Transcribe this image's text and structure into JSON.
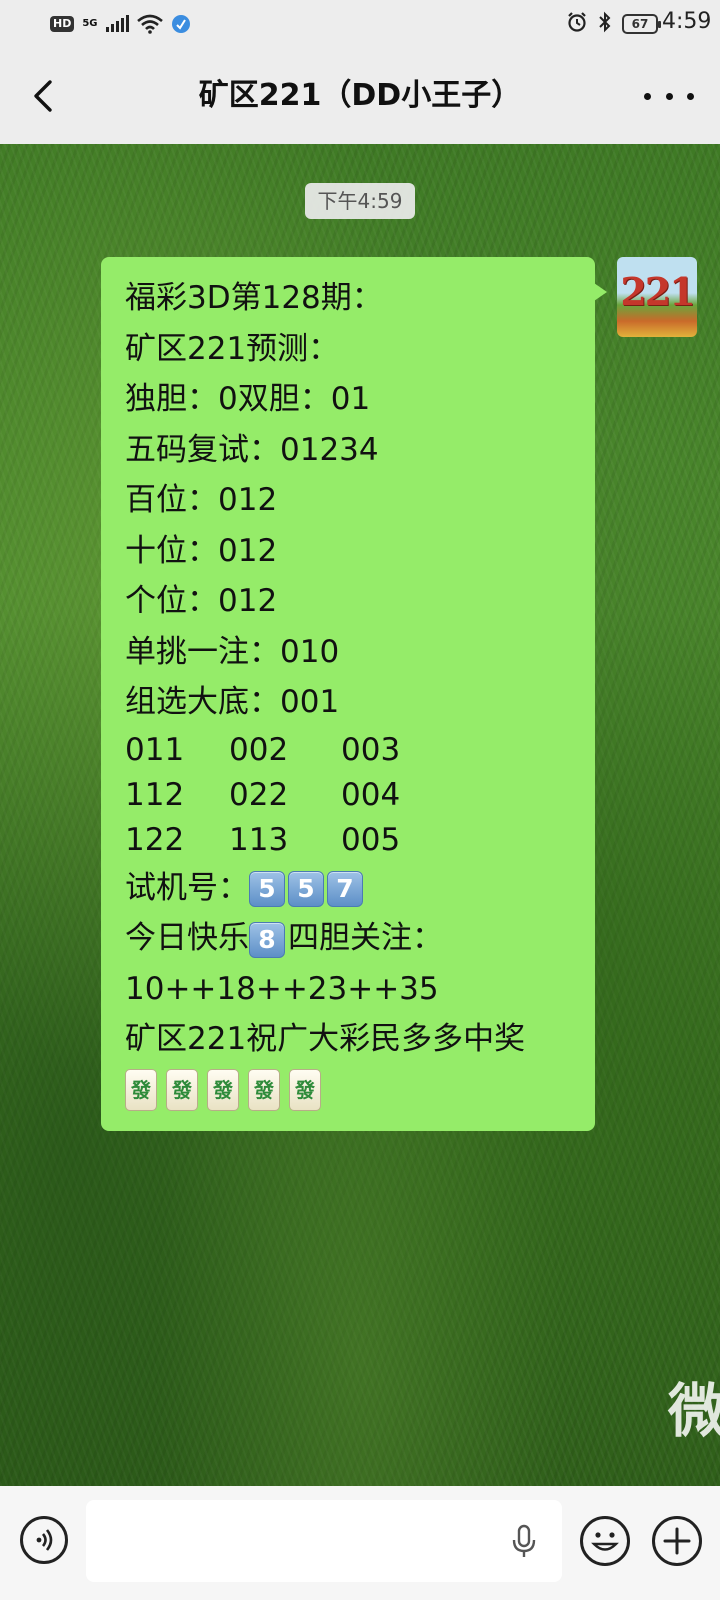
{
  "status_bar": {
    "hd": "HD",
    "network": "5G",
    "battery": "67",
    "time": "4:59"
  },
  "header": {
    "title": "矿区221（DD小王子）"
  },
  "chat": {
    "timestamp": "下午4:59",
    "avatar_text": "221",
    "background_text": "微",
    "message": {
      "line1": "福彩3D第128期：",
      "line2": "矿区221预测：",
      "line3": "独胆：0双胆：01",
      "line4": "五码复试：01234",
      "line5": "百位：012",
      "line6": "十位：012",
      "line7": "个位：012",
      "line8": "单挑一注：010",
      "line9": "组选大底：001",
      "grid": [
        [
          "011",
          "002",
          "003"
        ],
        [
          "112",
          "022",
          "004"
        ],
        [
          "122",
          "113",
          "005"
        ]
      ],
      "trial_label": "试机号：",
      "trial_digits": [
        "5",
        "5",
        "7"
      ],
      "today_prefix": "今日快乐",
      "today_digit": "8",
      "today_suffix": "四胆关注：",
      "numbers_line": "10++18++23++35",
      "blessing": "矿区221祝广大彩民多多中奖",
      "tiles": [
        "發",
        "發",
        "發",
        "發",
        "發"
      ]
    }
  }
}
